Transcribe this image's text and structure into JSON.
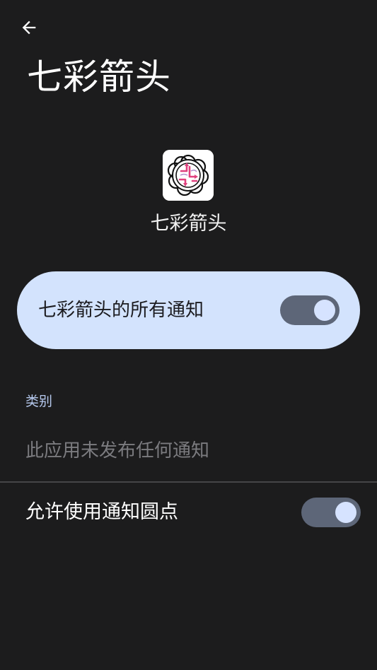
{
  "header": {
    "back_icon": "arrow-back-icon",
    "title": "七彩箭头"
  },
  "app": {
    "icon": "app-logo-icon",
    "name": "七彩箭头"
  },
  "all_notifications": {
    "label": "七彩箭头的所有通知",
    "enabled": true
  },
  "categories": {
    "header": "类别",
    "empty_text": "此应用未发布任何通知"
  },
  "notification_dots": {
    "label": "允许使用通知圆点",
    "enabled": true
  },
  "colors": {
    "background": "#1c1c1d",
    "card": "#d3e3fd",
    "switch_track": "#5d6678",
    "switch_thumb": "#d6e3ff",
    "section_header": "#b6c9ee"
  }
}
